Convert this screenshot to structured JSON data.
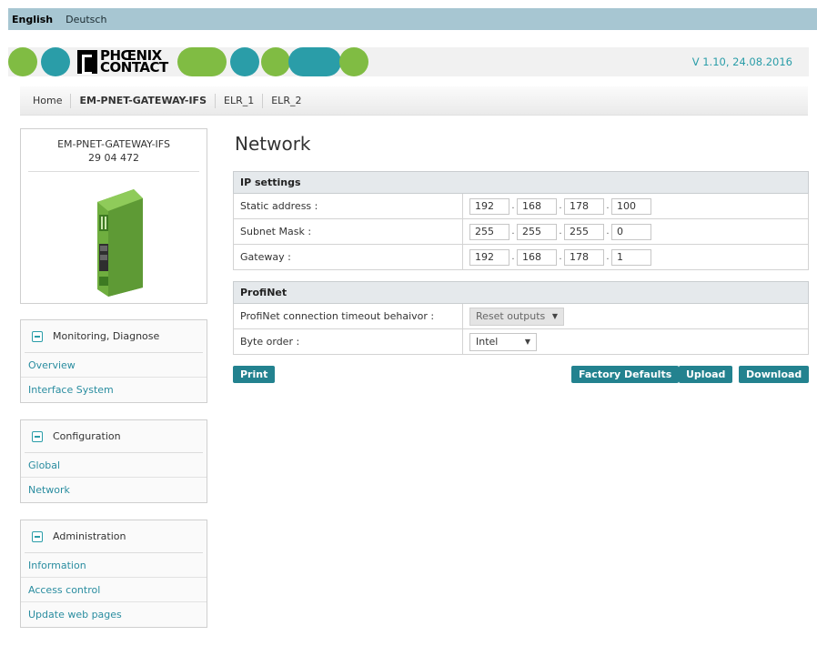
{
  "languages": [
    {
      "label": "English"
    },
    {
      "label": "Deutsch"
    }
  ],
  "brand": {
    "logo_line1": "PHŒNIX",
    "logo_line2": "CONTACT",
    "version": "V 1.10, 24.08.2016",
    "colors": {
      "green": "#80bc43",
      "teal": "#2a9da8"
    }
  },
  "nav": {
    "home": "Home",
    "device": "EM-PNET-GATEWAY-IFS",
    "elr1": "ELR_1",
    "elr2": "ELR_2"
  },
  "device": {
    "name": "EM-PNET-GATEWAY-IFS",
    "number": "29 04 472"
  },
  "menus": {
    "monitoring": {
      "title": "Monitoring, Diagnose",
      "items": [
        "Overview",
        "Interface System"
      ]
    },
    "configuration": {
      "title": "Configuration",
      "items": [
        "Global",
        "Network"
      ]
    },
    "administration": {
      "title": "Administration",
      "items": [
        "Information",
        "Access control",
        "Update web pages"
      ]
    }
  },
  "page": {
    "title": "Network"
  },
  "ip_settings": {
    "header": "IP settings",
    "static_label": "Static address :",
    "static": [
      "192",
      "168",
      "178",
      "100"
    ],
    "subnet_label": "Subnet Mask :",
    "subnet": [
      "255",
      "255",
      "255",
      "0"
    ],
    "gateway_label": "Gateway :",
    "gateway": [
      "192",
      "168",
      "178",
      "1"
    ]
  },
  "profinet": {
    "header": "ProfiNet",
    "timeout_label": "ProfiNet connection timeout behaivor :",
    "timeout_value": "Reset outputs",
    "byte_order_label": "Byte order :",
    "byte_order_value": "Intel"
  },
  "buttons": {
    "print": "Print",
    "factory": "Factory Defaults",
    "upload": "Upload",
    "download": "Download"
  }
}
